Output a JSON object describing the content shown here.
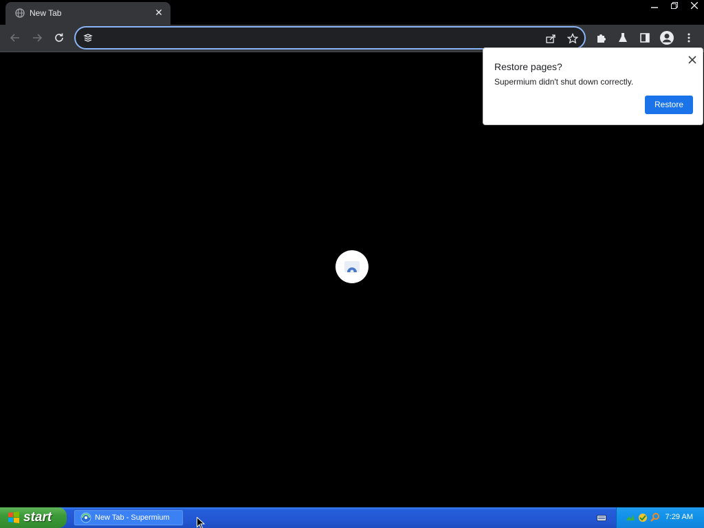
{
  "window": {
    "tab_title": "New Tab",
    "tab_close_symbol": "✕",
    "controls": [
      "minimize",
      "restore",
      "close"
    ]
  },
  "toolbar": {
    "omnibox_value": "",
    "omnibox_placeholder": "",
    "icons": [
      "back-icon",
      "forward-icon",
      "reload-icon",
      "share-icon",
      "bookmark-star-icon",
      "extensions-icon",
      "labs-flask-icon",
      "side-panel-icon",
      "profile-icon",
      "menu-icon"
    ]
  },
  "bubble": {
    "title": "Restore pages?",
    "message": "Supermium didn't shut down correctly.",
    "restore_label": "Restore",
    "close_symbol": "✕"
  },
  "taskbar": {
    "start_label": "start",
    "task_label": "New Tab - Supermium",
    "clock": "7:29 AM"
  },
  "colors": {
    "accent": "#1a73e8",
    "omnibox_focus": "#8ab4f8",
    "toolbar_bg": "#35363a",
    "taskbar_blue": "#245edb",
    "start_green": "#3c9a38"
  }
}
